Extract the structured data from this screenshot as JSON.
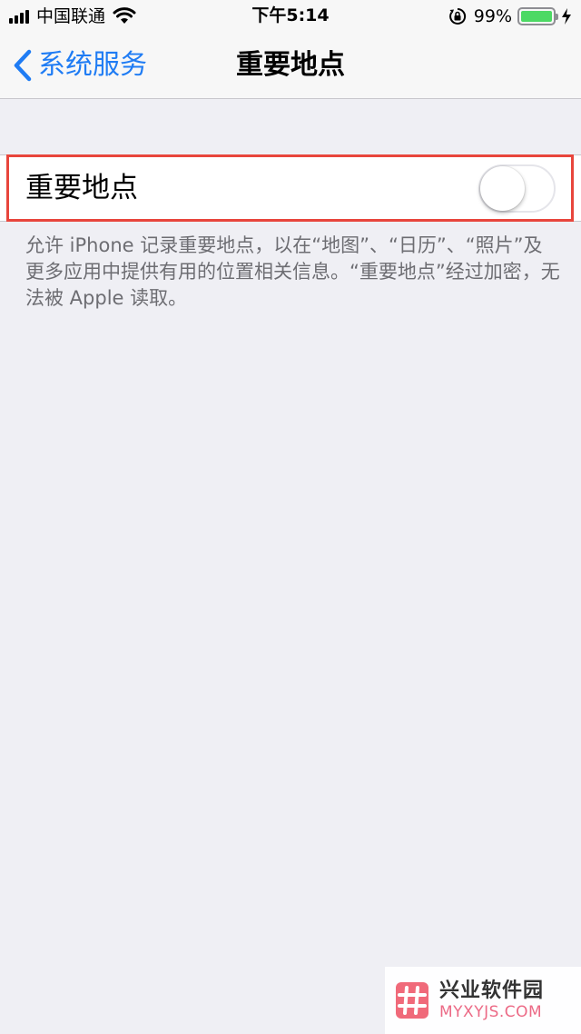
{
  "status_bar": {
    "carrier": "中国联通",
    "time": "下午5:14",
    "battery_percent": "99%",
    "battery_level": 0.99,
    "icons": [
      "signal-icon",
      "wifi-icon",
      "orientation-lock-icon",
      "battery-icon",
      "charging-icon"
    ]
  },
  "nav": {
    "back_label": "系统服务",
    "title": "重要地点"
  },
  "setting": {
    "label": "重要地点",
    "toggle_on": false
  },
  "footer": {
    "description": "允许 iPhone 记录重要地点，以在“地图”、“日历”、“照片”及更多应用中提供有用的位置相关信息。“重要地点”经过加密，无法被 Apple 读取。"
  },
  "watermark": {
    "brand_cn": "兴业软件园",
    "brand_en": "MYXYJS.COM"
  },
  "colors": {
    "accent": "#1f7cf4",
    "background": "#efeff4",
    "highlight": "#e8453c",
    "battery": "#4cd964"
  }
}
